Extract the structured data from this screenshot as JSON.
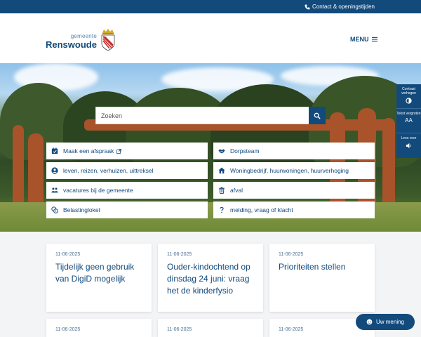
{
  "topbar": {
    "contact_label": "Contact & openingstijden"
  },
  "header": {
    "logo_small": "gemeente",
    "logo_name": "Renswoude",
    "menu_label": "MENU"
  },
  "search": {
    "placeholder": "Zoeken"
  },
  "quick_links": {
    "left": [
      {
        "label": "Maak een afspraak",
        "icon": "calendar-check-icon",
        "external": true
      },
      {
        "label": "leven, reizen, verhuizen, uittreksel",
        "icon": "user-circle-icon"
      },
      {
        "label": "vacatures bij de gemeente",
        "icon": "people-icon"
      },
      {
        "label": "Belastingloket",
        "icon": "coins-icon"
      }
    ],
    "right": [
      {
        "label": "Dorpsteam",
        "icon": "handshake-icon"
      },
      {
        "label": "Woningbedrijf, huurwoningen, huurverhoging",
        "icon": "house-icon"
      },
      {
        "label": "afval",
        "icon": "trash-icon"
      },
      {
        "label": "melding, vraag of klacht",
        "icon": "question-icon"
      }
    ]
  },
  "accessibility": {
    "contrast_label": "Contrast verhogen",
    "text_size_label": "Tekst vergroten",
    "text_size_glyph": "AA",
    "read_aloud_label": "Lees voor"
  },
  "news": [
    {
      "date": "11-06-2025",
      "title": "Tijdelijk geen gebruik van DigiD mogelijk"
    },
    {
      "date": "11-06-2025",
      "title": "Ouder-kindochtend op dinsdag 24 juni: vraag het de kinderfysio"
    },
    {
      "date": "11-06-2025",
      "title": "Prioriteiten stellen"
    },
    {
      "date": "11-06-2025",
      "title": ""
    },
    {
      "date": "11-06-2025",
      "title": ""
    },
    {
      "date": "11-06-2025",
      "title": ""
    }
  ],
  "feedback": {
    "label": "Uw mening"
  },
  "colors": {
    "primary": "#124a7c",
    "background": "#f3f4f6",
    "rust": "#a8532a"
  }
}
